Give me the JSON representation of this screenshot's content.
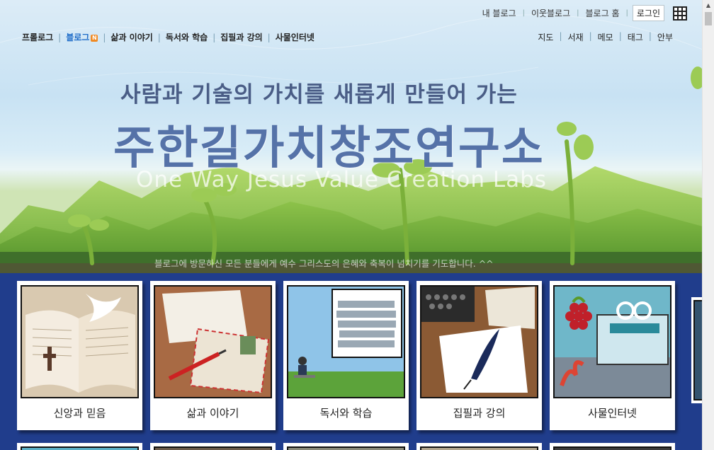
{
  "topbar": {
    "links": [
      "내 블로그",
      "이웃블로그",
      "블로그 홈"
    ],
    "login": "로그인",
    "apps_icon": "grid-icon"
  },
  "mainnav": {
    "items": [
      "프롤로그",
      "블로그",
      "삶과 이야기",
      "독서와 학습",
      "집필과 강의",
      "사물인터넷"
    ],
    "active_index": 1,
    "new_badge": "N"
  },
  "subnav": {
    "items": [
      "지도",
      "서재",
      "메모",
      "태그",
      "안부"
    ]
  },
  "banner": {
    "slogan": "사람과 기술의 가치를 새롭게 만들어 가는",
    "brand": "주한길가치창조연구소",
    "brand_en": "One Way Jesus Value Creation Labs",
    "welcome": "블로그에 방문하신 모든 분들에게 예수 그리스도의 은혜와 축복이 넘치기를 기도합니다. ^^"
  },
  "categories": [
    {
      "label": "신앙과 믿음",
      "image": "open-bible-with-cross"
    },
    {
      "label": "삶과 이야기",
      "image": "letters-and-pen"
    },
    {
      "label": "독서와 학습",
      "image": "books-and-reader"
    },
    {
      "label": "집필과 강의",
      "image": "typewriter-and-quill"
    },
    {
      "label": "사물인터넷",
      "image": "raspberry-pi-arduino"
    }
  ],
  "colors": {
    "category_bg": "#203d8c",
    "brand_text": "#5572a8",
    "active_nav": "#1e6cc8",
    "badge": "#f08a24"
  }
}
